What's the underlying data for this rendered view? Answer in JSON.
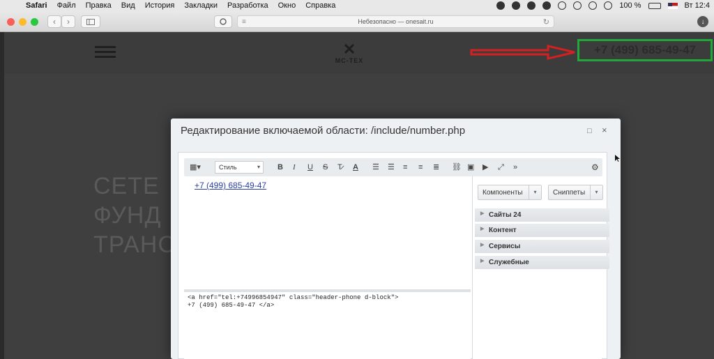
{
  "menubar": {
    "app": "Safari",
    "items": [
      "Файл",
      "Правка",
      "Вид",
      "История",
      "Закладки",
      "Разработка",
      "Окно",
      "Справка"
    ],
    "battery": "100 %",
    "clock": "Вт 12:4"
  },
  "toolbar": {
    "address": "Небезопасно — onesait.ru"
  },
  "page": {
    "logo_text": "MC-TEX",
    "phone": "+7 (499) 685-49-47",
    "hero": [
      "СЕТЕ",
      "ФУНД",
      "ТРАНС"
    ]
  },
  "dialog": {
    "title": "Редактирование включаемой области: /include/number.php",
    "editor": {
      "style_select": "Стиль",
      "content_link": "+7 (499) 685-49-47",
      "source_lines": [
        "<a href=\"tel:+74996854947\" class=\"header-phone d-block\">",
        "+7 (499) 685-49-47 </a>"
      ]
    },
    "side": {
      "components_label": "Компоненты",
      "snippets_label": "Сниппеты",
      "tree": [
        "Сайты 24",
        "Контент",
        "Сервисы",
        "Служебные"
      ]
    }
  },
  "colors": {
    "highlight_box": "#22a83a",
    "arrow": "#d32020"
  }
}
